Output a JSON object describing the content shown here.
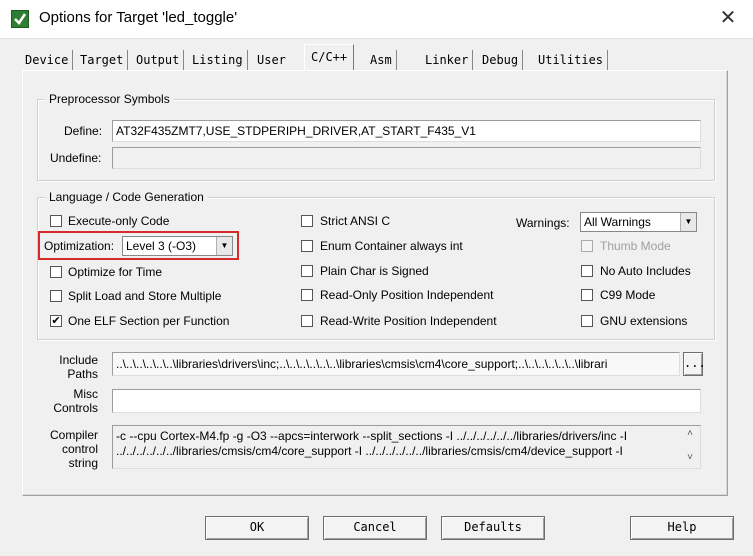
{
  "window": {
    "title": "Options for Target 'led_toggle'"
  },
  "tabs": [
    "Device",
    "Target",
    "Output",
    "Listing",
    "User",
    "C/C++",
    "Asm",
    "Linker",
    "Debug",
    "Utilities"
  ],
  "preprocessor": {
    "legend": "Preprocessor Symbols",
    "define_label": "Define:",
    "define_value": "AT32F435ZMT7,USE_STDPERIPH_DRIVER,AT_START_F435_V1",
    "undefine_label": "Undefine:",
    "undefine_value": ""
  },
  "language": {
    "legend": "Language / Code Generation",
    "execute_only": {
      "label": "Execute-only Code",
      "checked": false
    },
    "optimization_label": "Optimization:",
    "optimization_value": "Level 3 (-O3)",
    "optimize_time": {
      "label": "Optimize for Time",
      "checked": false
    },
    "split_load": {
      "label": "Split Load and Store Multiple",
      "checked": false
    },
    "one_elf": {
      "label": "One ELF Section per Function",
      "checked": true,
      "mark": "✔"
    },
    "strict_ansi": {
      "label": "Strict ANSI C",
      "checked": false
    },
    "enum_container": {
      "label": "Enum Container always int",
      "checked": false
    },
    "plain_char": {
      "label": "Plain Char is Signed",
      "checked": false
    },
    "ro_pos": {
      "label": "Read-Only Position Independent",
      "checked": false
    },
    "rw_pos": {
      "label": "Read-Write Position Independent",
      "checked": false
    },
    "warnings_label": "Warnings:",
    "warnings_value": "All Warnings",
    "thumb_mode": {
      "label": "Thumb Mode",
      "checked": false,
      "disabled": true
    },
    "no_auto_includes": {
      "label": "No Auto Includes",
      "checked": false
    },
    "c99": {
      "label": "C99 Mode",
      "checked": false
    },
    "gnu_ext": {
      "label": "GNU extensions",
      "checked": false
    }
  },
  "include": {
    "label_line1": "Include",
    "label_line2": "Paths",
    "value": "..\\..\\..\\..\\..\\..\\libraries\\drivers\\inc;..\\..\\..\\..\\..\\..\\libraries\\cmsis\\cm4\\core_support;..\\..\\..\\..\\..\\..\\librari",
    "browse_label": "..."
  },
  "misc": {
    "label_line1": "Misc",
    "label_line2": "Controls",
    "value": ""
  },
  "compiler": {
    "label_line1": "Compiler",
    "label_line2": "control",
    "label_line3": "string",
    "line1": "-c --cpu Cortex-M4.fp -g -O3 --apcs=interwork --split_sections -I ../../../../../../libraries/drivers/inc -I",
    "line2": "../../../../../../libraries/cmsis/cm4/core_support -I ../../../../../../libraries/cmsis/cm4/device_support -I",
    "scroll_up": "˄",
    "scroll_down": "˅"
  },
  "buttons": {
    "ok": "OK",
    "cancel": "Cancel",
    "defaults": "Defaults",
    "help": "Help"
  },
  "colors": {
    "highlight": "#d62b2b",
    "icon": "#2e7d32"
  }
}
